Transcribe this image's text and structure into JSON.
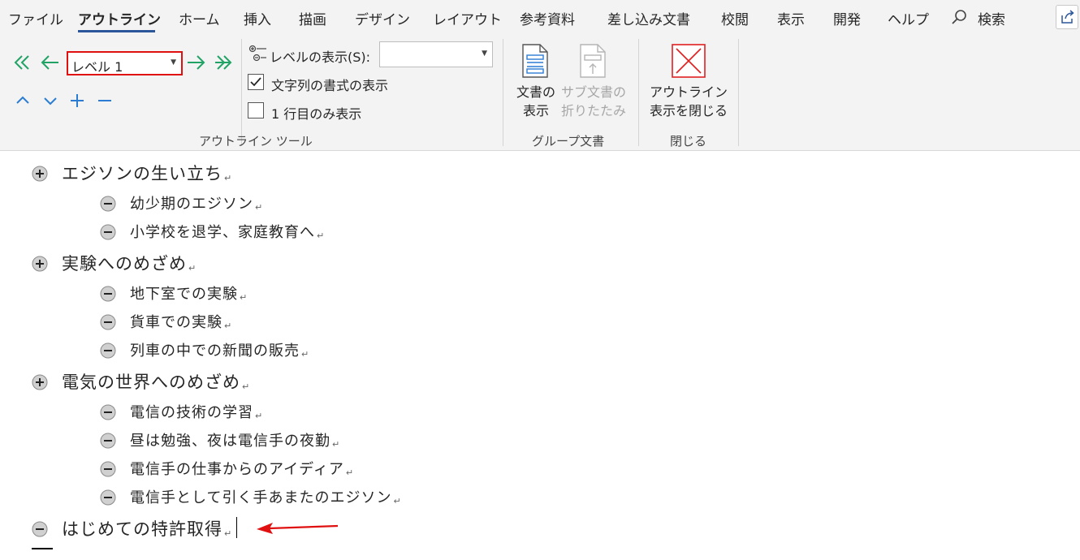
{
  "ribbon_tabs": [
    "ファイル",
    "アウトライン",
    "ホーム",
    "挿入",
    "描画",
    "デザイン",
    "レイアウト",
    "参考資料",
    "差し込み文書",
    "校閲",
    "表示",
    "開発",
    "ヘルプ"
  ],
  "active_tab": "アウトライン",
  "search_label": "検索",
  "outline_tools": {
    "level_value": "レベル 1",
    "show_level_label": "レベルの表示(S):",
    "show_level_value": "",
    "show_formatting_label": "文字列の書式の表示",
    "show_formatting_checked": true,
    "first_line_only_label": "1 行目のみ表示",
    "first_line_only_checked": false,
    "group_label": "アウトライン ツール"
  },
  "master_document": {
    "show_document_line1": "文書の",
    "show_document_line2": "表示",
    "collapse_sub_line1": "サブ文書の",
    "collapse_sub_line2": "折りたたみ",
    "group_label": "グループ文書"
  },
  "close_group": {
    "close_outline_line1": "アウトライン",
    "close_outline_line2": "表示を閉じる",
    "group_label": "閉じる"
  },
  "outline": [
    {
      "level": 1,
      "text": "エジソンの生い立ち",
      "symbol": "plus"
    },
    {
      "level": 2,
      "text": "幼少期のエジソン",
      "symbol": "minus"
    },
    {
      "level": 2,
      "text": "小学校を退学、家庭教育へ",
      "symbol": "minus"
    },
    {
      "level": 1,
      "text": "実験へのめざめ",
      "symbol": "plus"
    },
    {
      "level": 2,
      "text": "地下室での実験",
      "symbol": "minus"
    },
    {
      "level": 2,
      "text": "貨車での実験",
      "symbol": "minus"
    },
    {
      "level": 2,
      "text": "列車の中での新聞の販売",
      "symbol": "minus"
    },
    {
      "level": 1,
      "text": "電気の世界へのめざめ",
      "symbol": "plus"
    },
    {
      "level": 2,
      "text": "電信の技術の学習",
      "symbol": "minus"
    },
    {
      "level": 2,
      "text": "昼は勉強、夜は電信手の夜勤",
      "symbol": "minus"
    },
    {
      "level": 2,
      "text": "電信手の仕事からのアイディア",
      "symbol": "minus"
    },
    {
      "level": 2,
      "text": "電信手として引く手あまたのエジソン",
      "symbol": "minus"
    },
    {
      "level": 1,
      "text": "はじめての特許取得",
      "symbol": "minus"
    }
  ],
  "paragraph_mark": "↵",
  "colors": {
    "accent": "#2b579a",
    "arrow_green": "#21a366",
    "highlight_red": "#e01010"
  }
}
